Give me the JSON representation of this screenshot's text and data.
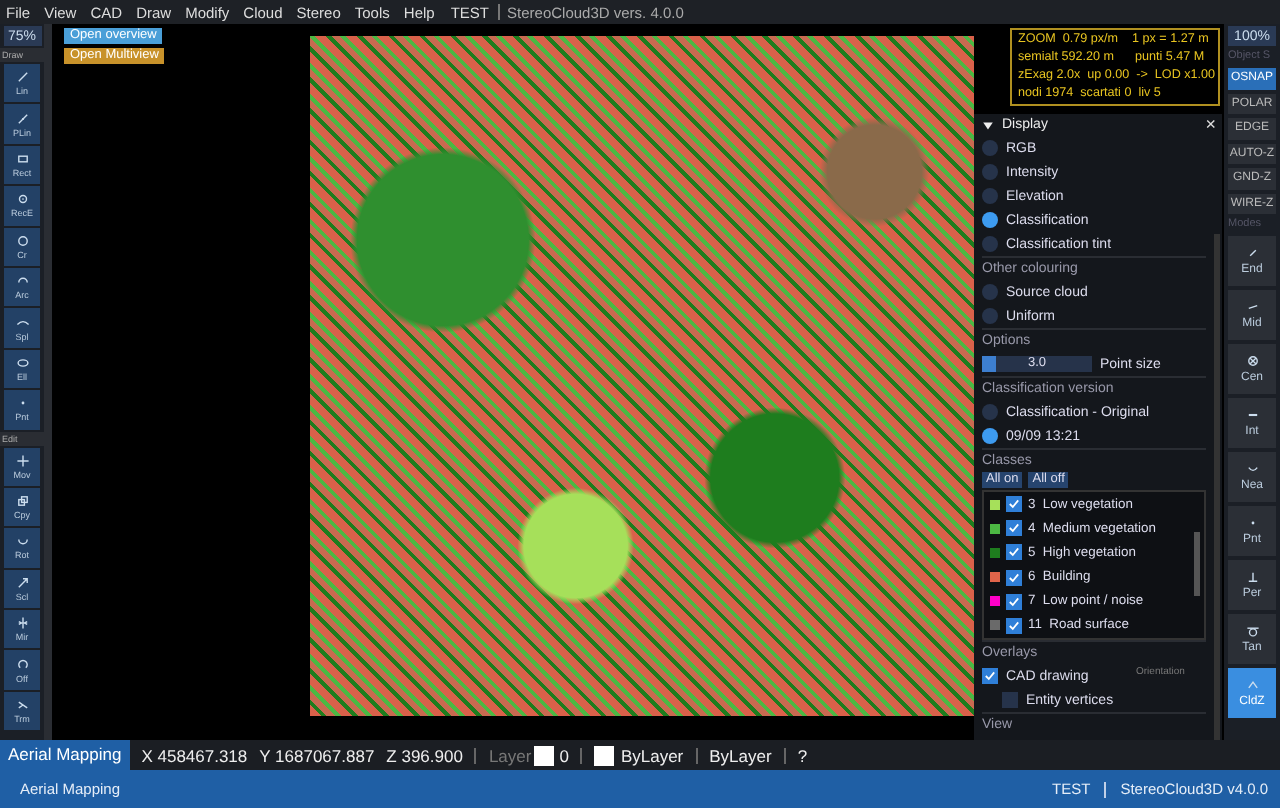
{
  "menu": {
    "items": [
      "File",
      "View",
      "CAD",
      "Draw",
      "Modify",
      "Cloud",
      "Stereo",
      "Tools",
      "Help"
    ],
    "project": "TEST",
    "app_title": "StereoCloud3D vers. 4.0.0"
  },
  "left_toolbar": {
    "zoom": "75%",
    "groups": [
      {
        "label": "Draw",
        "tools": [
          "Lin",
          "PLin",
          "Rect",
          "RecE",
          "Cr",
          "Arc",
          "Spl",
          "Ell",
          "Pnt"
        ]
      },
      {
        "label": "Edit",
        "tools": [
          "Mov",
          "Cpy",
          "Rot",
          "Scl",
          "Mir",
          "Off",
          "Trm"
        ]
      }
    ]
  },
  "viewport": {
    "buttons": [
      {
        "label": "Open overview",
        "color": "#4a9fd8"
      },
      {
        "label": "Open Multiview",
        "color": "#c8922a"
      }
    ],
    "info_lines": [
      "ZOOM  0.79 px/m    1 px = 1.27 m",
      "semialt 592.20 m      punti 5.47 M",
      "zExag 2.0x  up 0.00  ->  LOD x1.00",
      "nodi 1974  scartati 0  liv 5"
    ]
  },
  "panel": {
    "title": "Display",
    "close": "×",
    "display_modes": [
      {
        "label": "RGB",
        "selected": false
      },
      {
        "label": "Intensity",
        "selected": false
      },
      {
        "label": "Elevation",
        "selected": false
      },
      {
        "label": "Classification",
        "selected": true
      },
      {
        "label": "Classification tint",
        "selected": false
      }
    ],
    "other_heading": "Other colouring",
    "other_modes": [
      {
        "label": "Source cloud",
        "selected": false
      },
      {
        "label": "Uniform",
        "selected": false
      }
    ],
    "options_heading": "Options",
    "point_size": {
      "value": "3.0",
      "level": 0.12,
      "label": "Point size"
    },
    "version_heading": "Classification version",
    "versions": [
      {
        "label": "Classification - Original",
        "selected": false
      },
      {
        "label": "09/09 13:21",
        "selected": true
      }
    ],
    "classes_heading": "Classes",
    "class_buttons": [
      "All on",
      "All off"
    ],
    "classes": [
      {
        "label": "3  Low vegetation",
        "color": "#a6e05a",
        "checked": true
      },
      {
        "label": "4  Medium vegetation",
        "color": "#4cb843",
        "checked": true
      },
      {
        "label": "5  High vegetation",
        "color": "#1e7d1e",
        "checked": true
      },
      {
        "label": "6  Building",
        "color": "#e0644a",
        "checked": true
      },
      {
        "label": "7  Low point / noise",
        "color": "#ff00c8",
        "checked": true
      },
      {
        "label": "11  Road surface",
        "color": "#6a6a6a",
        "checked": true
      }
    ],
    "overlays_heading": "Overlays",
    "overlays": [
      {
        "label": "CAD drawing",
        "checked": true
      },
      {
        "label": "Entity vertices",
        "checked": false
      }
    ],
    "orientation_label": "Orientation",
    "view_heading": "View"
  },
  "right_toolbar": {
    "zoom": "100%",
    "heading": "Object S",
    "toggles": [
      {
        "label": "OSNAP",
        "on": true
      },
      {
        "label": "POLAR",
        "on": false
      },
      {
        "label": "EDGE",
        "on": false
      },
      {
        "label": "AUTO-Z",
        "on": false
      },
      {
        "label": "GND-Z",
        "on": false
      },
      {
        "label": "WIRE-Z",
        "on": false
      }
    ],
    "modes_heading": "Modes",
    "snaps": [
      {
        "label": "End",
        "selected": false
      },
      {
        "label": "Mid",
        "selected": false
      },
      {
        "label": "Cen",
        "selected": false
      },
      {
        "label": "Int",
        "selected": false
      },
      {
        "label": "Nea",
        "selected": false
      },
      {
        "label": "Pnt",
        "selected": false
      },
      {
        "label": "Per",
        "selected": false
      },
      {
        "label": "Tan",
        "selected": false
      },
      {
        "label": "CldZ",
        "selected": true
      }
    ]
  },
  "status_bar": {
    "mode": "Aerial Mapping",
    "x": "X 458467.318",
    "y": "Y 1687067.887",
    "z": "Z 396.900",
    "layer_label": "Layer",
    "layer": "0",
    "color_setting": "ByLayer",
    "linetype": "ByLayer",
    "help": "?"
  },
  "bottom_bar": {
    "workspace": "Aerial Mapping",
    "project": "TEST",
    "version": "StereoCloud3D v4.0.0"
  }
}
